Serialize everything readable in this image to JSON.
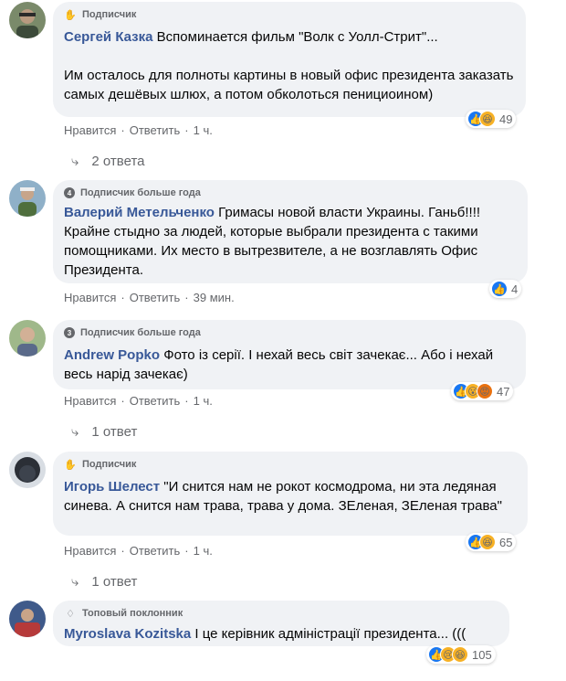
{
  "comments": [
    {
      "badge": "Подписчик",
      "author": "Сергей Казка",
      "text": "Вспоминается фильм \"Волк с Уолл-Стрит\"...\n\nИм осталось для полноты картины в новый офис президента заказать самых дешёвых шлюх, а потом обколоться пенициоином)",
      "like_label": "Нравится",
      "reply_label": "Ответить",
      "time": "1 ч.",
      "reaction_count": "49",
      "replies_label": "2 ответа"
    },
    {
      "badge": "Подписчик больше года",
      "badge_num": "4",
      "author": "Валерий Метельченко",
      "text": "Гримасы новой власти Украины. Ганьб!!!! Крайне стыдно за людей, которые выбрали президента с такими помощниками. Их место в вытрезвителе, а не возглавлять Офис Президента.",
      "like_label": "Нравится",
      "reply_label": "Ответить",
      "time": "39 мин.",
      "reaction_count": "4"
    },
    {
      "badge": "Подписчик больше года",
      "badge_num": "3",
      "author": "Andrew Popko",
      "text": "Фото із серії. І нехай весь світ зачекає... Або і нехай весь нарід зачекає)",
      "like_label": "Нравится",
      "reply_label": "Ответить",
      "time": "1 ч.",
      "reaction_count": "47",
      "replies_label": "1 ответ"
    },
    {
      "badge": "Подписчик",
      "author": "Игорь Шелест",
      "text": "\"И снится нам не рокот космодрома, ни эта ледяная синева. А снится нам трава, трава у дома. ЗЕленая, ЗЕленая трава\"",
      "like_label": "Нравится",
      "reply_label": "Ответить",
      "time": "1 ч.",
      "reaction_count": "65",
      "replies_label": "1 ответ"
    },
    {
      "badge": "Топовый поклонник",
      "author": "Myroslava Kozitska",
      "text": "І це керівник адміністрації президента... (((",
      "reaction_count": "105"
    }
  ],
  "separator": "·",
  "icons": {
    "follower": "waving-hand-icon",
    "top_fan": "diamond-icon",
    "reply": "reply-arrow-icon",
    "reactions": [
      "like-reaction-icon",
      "haha-reaction-icon",
      "wow-reaction-icon",
      "angry-reaction-icon",
      "sad-reaction-icon"
    ]
  },
  "colors": {
    "bubble": "#f0f2f5",
    "author": "#385898",
    "meta": "#65676b",
    "like": "#1877f2",
    "haha": "#f7b125",
    "angry": "#e9710f"
  }
}
